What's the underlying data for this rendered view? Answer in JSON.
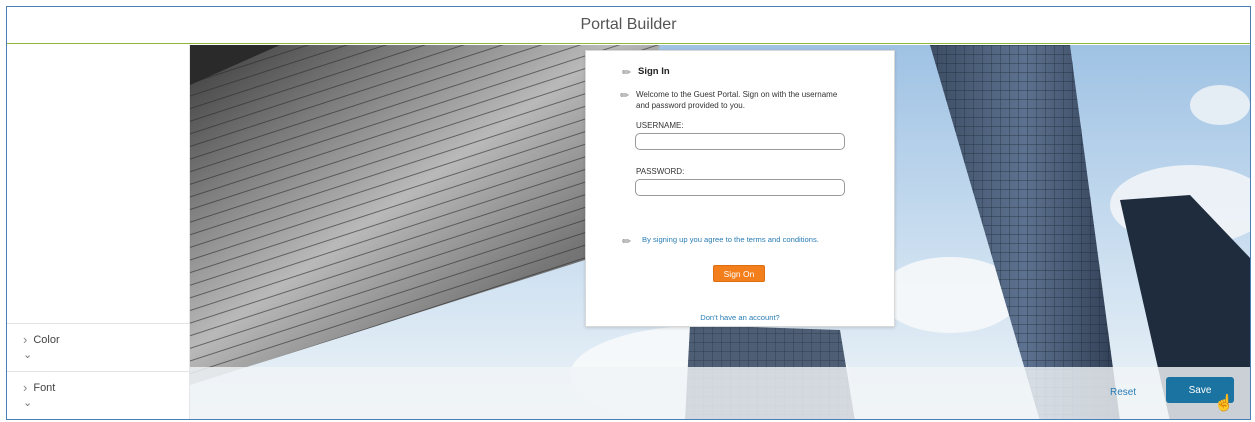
{
  "header": {
    "title": "Portal Builder"
  },
  "sidebar": {
    "sections": [
      {
        "label": "Color"
      },
      {
        "label": "Font"
      }
    ]
  },
  "card": {
    "title": "Sign In",
    "welcome": "Welcome to the Guest Portal. Sign on with the username and password provided to you.",
    "username_label": "USERNAME:",
    "username_value": "",
    "password_label": "PASSWORD:",
    "password_value": "",
    "terms_text": "By signing up you agree to the terms and conditions.",
    "sign_on_label": "Sign On",
    "no_account_text": "Don't have an account?"
  },
  "footer": {
    "reset_label": "Reset",
    "save_label": "Save"
  },
  "colors": {
    "header_border": "#8fb83a",
    "sign_on_button": "#f27e1c",
    "save_button": "#1a73a0",
    "link": "#2a7db5"
  },
  "icons": [
    "chevron-right-icon",
    "chevron-down-icon",
    "pencil-icon",
    "hand-cursor-icon"
  ]
}
